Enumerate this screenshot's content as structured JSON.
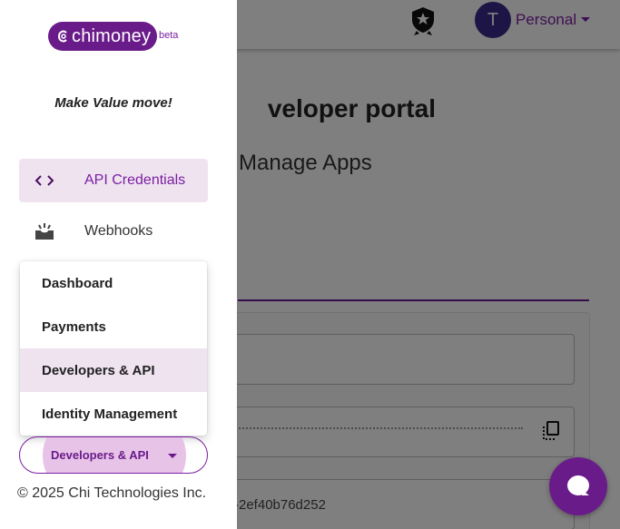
{
  "header": {
    "avatar_initial": "T",
    "account_label": "Personal"
  },
  "main": {
    "title": "veloper portal",
    "subtitle": "Manage Apps",
    "field3_value": "-2ef40b76d252"
  },
  "drawer": {
    "logo_text": "chimoney",
    "logo_badge": "beta",
    "tagline": "Make Value move!",
    "nav": [
      {
        "label": "API Credentials",
        "icon": "code-brackets-icon",
        "active": true
      },
      {
        "label": "Webhooks",
        "icon": "webhook-icon",
        "active": false
      }
    ],
    "menu": [
      {
        "label": "Dashboard"
      },
      {
        "label": "Payments"
      },
      {
        "label": "Developers & API",
        "selected": true
      },
      {
        "label": "Identity Management"
      }
    ],
    "switcher_label": "Developers & API",
    "footer": "© 2025 Chi Technologies Inc."
  },
  "colors": {
    "brand": "#6a1b8a",
    "brand_text": "#7a1fa2",
    "active_bg": "#efe3f0",
    "overlay": "rgba(0,0,0,0.5)"
  }
}
